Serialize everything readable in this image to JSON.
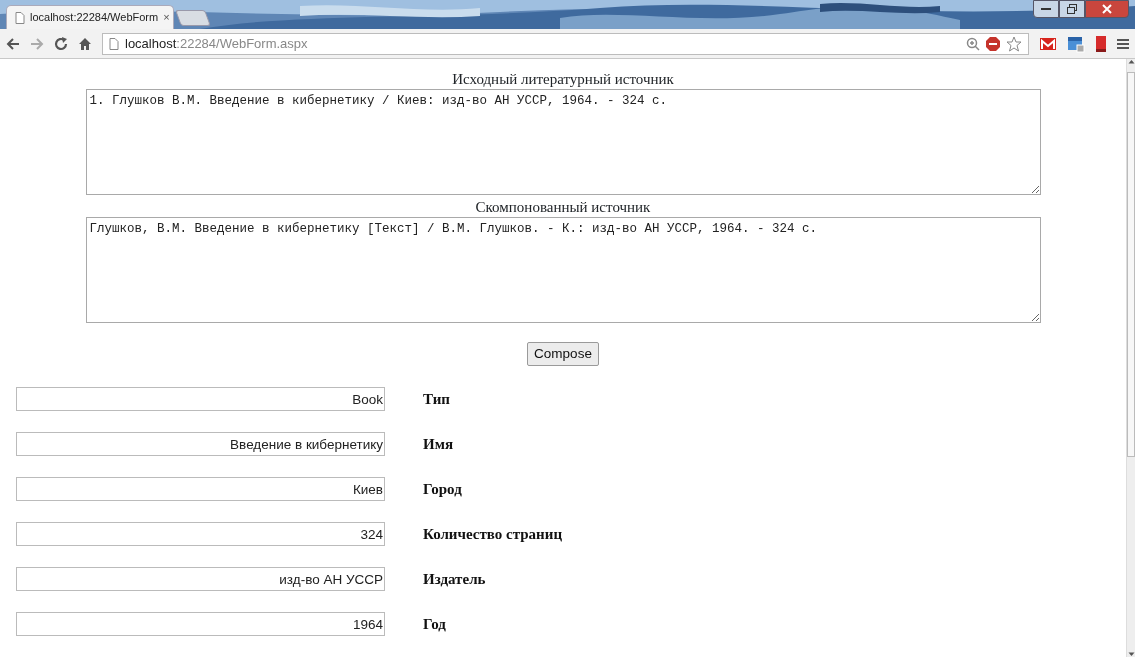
{
  "browser": {
    "tab": {
      "title": "localhost:22284/WebForm",
      "close": "×"
    },
    "address": {
      "host": "localhost",
      "path": ":22284/WebForm.aspx"
    }
  },
  "sections": [
    {
      "heading": "Исходный литературный источник",
      "text": "1. Глушков В.М. Введение в кибернетику / Киев: изд-во АН УССР, 1964. - 324 с."
    },
    {
      "heading": "Скомпонованный источник",
      "text": "Глушков, В.М. Введение в кибернетику [Текст] / В.М. Глушков. - К.: изд-во АН УССР, 1964. - 324 с."
    }
  ],
  "compose_button": "Compose",
  "fields": [
    {
      "value": "Book",
      "label": "Тип"
    },
    {
      "value": "Введение в кибернетику",
      "label": "Имя"
    },
    {
      "value": "Киев",
      "label": "Город"
    },
    {
      "value": "324",
      "label": "Количество страниц"
    },
    {
      "value": "изд-во АН УССР",
      "label": "Издатель"
    },
    {
      "value": "1964",
      "label": "Год"
    }
  ]
}
